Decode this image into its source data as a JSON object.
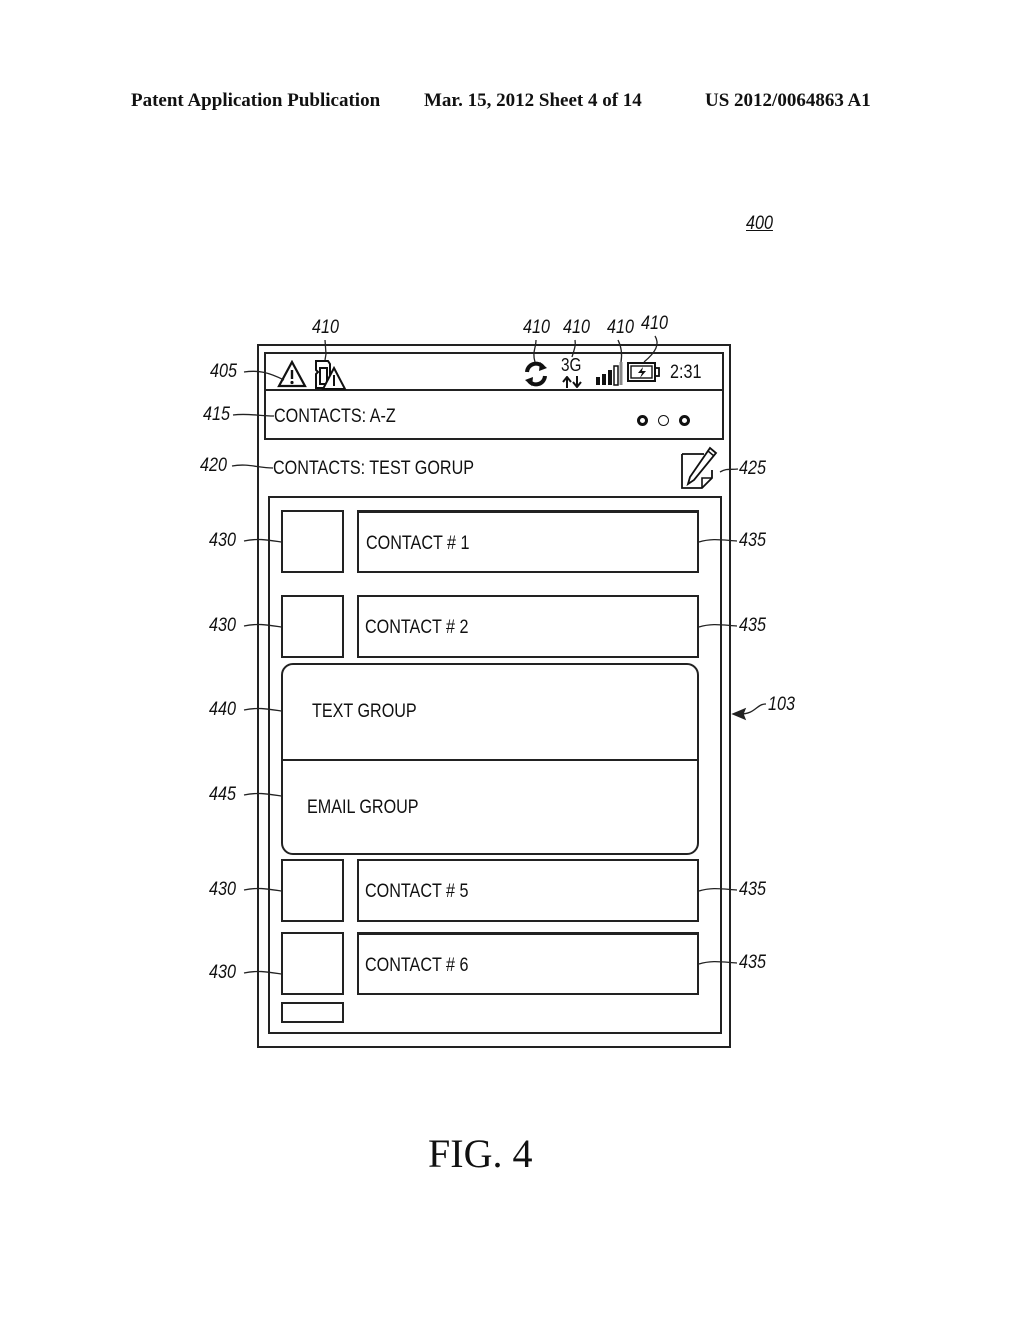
{
  "header": {
    "publication": "Patent Application Publication",
    "date_sheet": "Mar. 15, 2012  Sheet 4 of 14",
    "patent_number": "US 2012/0064863 A1"
  },
  "figure": {
    "number_label": "400",
    "caption": "FIG. 4",
    "device_ref": "103"
  },
  "status_bar": {
    "ref": "405",
    "icons": [
      {
        "name": "warning-icon",
        "ref": ""
      },
      {
        "name": "sd-card-warning-icon",
        "ref": "410"
      },
      {
        "name": "sync-icon",
        "ref": "410"
      },
      {
        "name": "network-3g-icon",
        "ref": "410",
        "text": "3G"
      },
      {
        "name": "signal-strength-icon",
        "ref": "410"
      },
      {
        "name": "battery-charging-icon",
        "ref": "410"
      }
    ],
    "time": "2:31"
  },
  "title_bar": {
    "ref": "415",
    "title": "CONTACTS: A-Z",
    "page_dots": 3,
    "active_dot": 2
  },
  "group_header": {
    "ref": "420",
    "title": "CONTACTS: TEST GORUP",
    "edit_ref": "425"
  },
  "contacts": [
    {
      "label": "CONTACT # 1",
      "thumb_ref": "430",
      "name_ref": "435"
    },
    {
      "label": "CONTACT # 2",
      "thumb_ref": "430",
      "name_ref": "435"
    },
    {
      "label": "CONTACT # 5",
      "thumb_ref": "430",
      "name_ref": "435"
    },
    {
      "label": "CONTACT # 6",
      "thumb_ref": "430",
      "name_ref": "435"
    }
  ],
  "popup_menu": {
    "items": [
      {
        "label": "TEXT GROUP",
        "ref": "440"
      },
      {
        "label": "EMAIL GROUP",
        "ref": "445"
      }
    ]
  }
}
